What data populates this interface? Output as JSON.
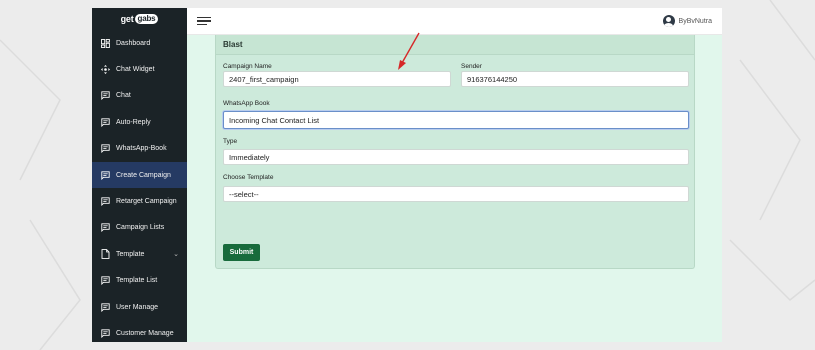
{
  "brand": {
    "prefix": "get",
    "bubble": "gabs"
  },
  "sidebar": {
    "items": [
      {
        "label": "Dashboard",
        "icon": "dashboard-icon"
      },
      {
        "label": "Chat Widget",
        "icon": "move-icon"
      },
      {
        "label": "Chat",
        "icon": "chat-icon"
      },
      {
        "label": "Auto-Reply",
        "icon": "chat-icon"
      },
      {
        "label": "WhatsApp-Book",
        "icon": "chat-icon"
      },
      {
        "label": "Create Campaign",
        "icon": "chat-icon",
        "active": true
      },
      {
        "label": "Retarget Campaign",
        "icon": "chat-icon"
      },
      {
        "label": "Campaign Lists",
        "icon": "chat-icon"
      },
      {
        "label": "Template",
        "icon": "document-icon",
        "chevron": "⌄"
      },
      {
        "label": "Template List",
        "icon": "chat-icon"
      },
      {
        "label": "User Manage",
        "icon": "chat-icon"
      },
      {
        "label": "Customer Manage",
        "icon": "chat-icon"
      }
    ]
  },
  "topbar": {
    "user_name": "ByBvNutra"
  },
  "form": {
    "title": "Blast",
    "campaign_name": {
      "label": "Campaign Name",
      "value": "2407_first_campaign"
    },
    "sender": {
      "label": "Sender",
      "value": "916376144250"
    },
    "whatsapp_book": {
      "label": "WhatsApp Book",
      "value": "Incoming Chat Contact List"
    },
    "type": {
      "label": "Type",
      "value": "Immediately"
    },
    "template": {
      "label": "Choose Template",
      "value": "--select--"
    },
    "submit_label": "Submit"
  },
  "colors": {
    "sidebar_bg": "#1b2327",
    "sidebar_active": "#253a63",
    "content_bg": "#e1f7ec",
    "card_bg": "#cdeadb",
    "submit_bg": "#186b3c",
    "annotation_arrow": "#d62828"
  }
}
